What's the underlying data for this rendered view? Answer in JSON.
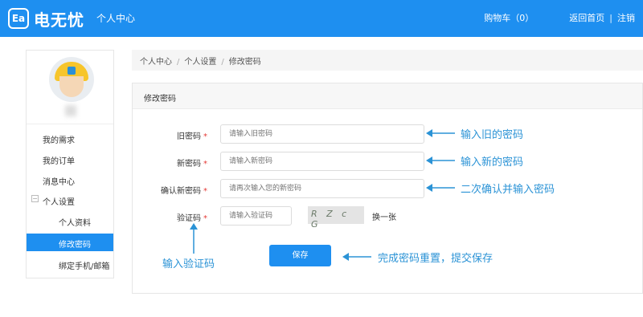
{
  "header": {
    "logo_badge": "Ea",
    "logo_text": "电无忧",
    "title": "个人中心",
    "cart": "购物车（0）",
    "home_link": "返回首页",
    "divider": "|",
    "logout": "注销"
  },
  "sidebar": {
    "items": [
      {
        "label": "我的需求"
      },
      {
        "label": "我的订单"
      },
      {
        "label": "消息中心"
      }
    ],
    "group": {
      "toggle": "−",
      "label": "个人设置"
    },
    "sub_items": [
      {
        "label": "个人资料"
      },
      {
        "label": "修改密码",
        "active": true
      },
      {
        "label": "绑定手机/邮箱"
      }
    ]
  },
  "breadcrumb": [
    "个人中心",
    "个人设置",
    "修改密码"
  ],
  "breadcrumb_sep": "/",
  "panel": {
    "title": "修改密码",
    "required_mark": "*",
    "fields": [
      {
        "label": "旧密码",
        "placeholder": "请输入旧密码"
      },
      {
        "label": "新密码",
        "placeholder": "请输入新密码"
      },
      {
        "label": "确认新密码",
        "placeholder": "请再次输入您的新密码"
      },
      {
        "label": "验证码",
        "placeholder": "请输入验证码"
      }
    ],
    "captcha_text": "R Z c G",
    "refresh_label": "换一张",
    "save_label": "保存"
  },
  "annotations": {
    "old_password": "输入旧的密码",
    "new_password": "输入新的密码",
    "confirm_password": "二次确认并输入密码",
    "captcha": "输入验证码",
    "save": "完成密码重置，提交保存"
  },
  "colors": {
    "primary": "#1e8ff0",
    "annotation": "#2b93d6",
    "required": "#e53935"
  }
}
